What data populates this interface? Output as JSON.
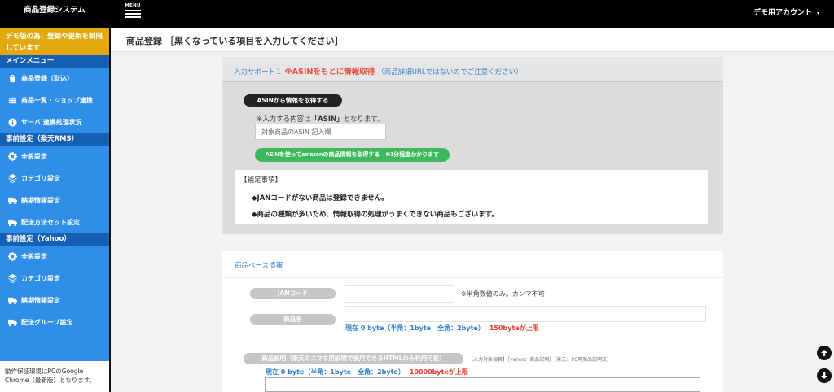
{
  "app": {
    "brand": "商品登録システム",
    "menu_label": "MENU",
    "account": "デモ用アカウント",
    "account_caret": "▾"
  },
  "sidebar": {
    "demo_notice": "デモ版の為、登録や更新を制限しています",
    "sections": [
      {
        "title": "メインメニュー",
        "items": [
          {
            "label": "商品登録（取込）",
            "icon": "shopping-bag-icon"
          },
          {
            "label": "商品一覧・ショップ連携",
            "icon": "list-icon"
          },
          {
            "label": "サーバ 連携処理状況",
            "icon": "info-icon"
          }
        ]
      },
      {
        "title": "事前設定（楽天RMS）",
        "items": [
          {
            "label": "全般設定",
            "icon": "gear-icon"
          },
          {
            "label": "カテゴリ設定",
            "icon": "layers-icon"
          },
          {
            "label": "納期情報設定",
            "icon": "truck-icon"
          },
          {
            "label": "配送方法セット設定",
            "icon": "truck-icon"
          }
        ]
      },
      {
        "title": "事前設定（Yahoo）",
        "items": [
          {
            "label": "全般設定",
            "icon": "gear-icon"
          },
          {
            "label": "カテゴリ設定",
            "icon": "layers-icon"
          },
          {
            "label": "納期情報設定",
            "icon": "truck-icon"
          },
          {
            "label": "配送グループ設定",
            "icon": "truck-icon"
          }
        ]
      }
    ],
    "footer": "動作保証環境はPCのGoogle Chrome（最新版）となります。"
  },
  "page": {
    "title": "商品登録 ［黒くなっている項目を入力してください］"
  },
  "support": {
    "label": "入力サポート１",
    "asin_title": "※ASINをもとに情報取得",
    "note": "（商品詳細URLではないのでご注意ください）",
    "pill": "ASINから情報を取得する",
    "input_note_prefix": "※入力する内容は",
    "input_note_key": "「ASIN」",
    "input_note_suffix": "となります。",
    "input_placeholder": "対象商品のASIN 記入欄",
    "fetch_button": "ASINを使ってamazonの商品情報を取得する",
    "fetch_time": "※1分程度かかります",
    "remarks_head": "【補足事項】",
    "remarks": [
      "◆JANコードがない商品は登録できません。",
      "◆商品の種類が多いため、情報取得の処理がうまくできない商品もございます。"
    ]
  },
  "base_info": {
    "title": "商品ベース情報",
    "jan_label": "JANコード",
    "jan_hint": "※半角数値のみ。カンマ不可",
    "name_label": "商品名",
    "name_bytes": "現在 0 byte（半角：1byte　全角：2byte）",
    "name_limit": "150byteが上限",
    "desc_label": "商品説明（楽天のスマホ用説明で使用できるHTMLのみ利用可能）",
    "desc_tags": "【入力対象項目】［yahoo：商品説明］［楽天：PC用商品説明文］",
    "desc_bytes": "現在 0 byte（半角：1byte　全角：2byte）",
    "desc_limit": "10000byteが上限"
  }
}
